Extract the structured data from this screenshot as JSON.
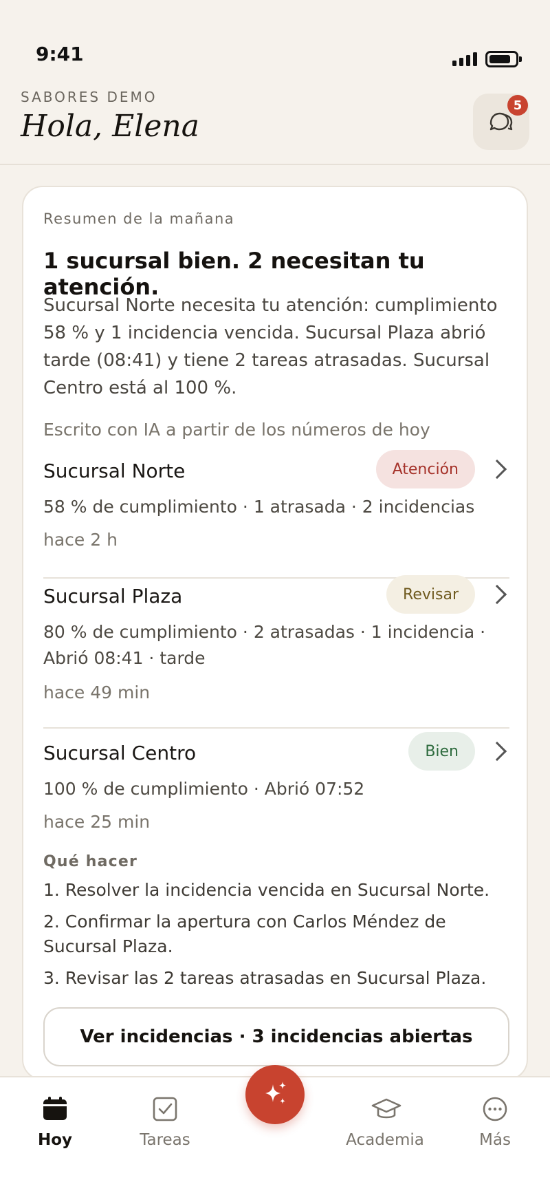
{
  "status_bar": {
    "time": "9:41"
  },
  "header": {
    "brand": "SABORES DEMO",
    "greeting": "Hola, Elena",
    "notifications_count": "5"
  },
  "summary_card": {
    "label": "Resumen de la mañana",
    "headline": "1 sucursal bien. 2 necesitan tu atención.",
    "body": "Sucursal Norte necesita tu atención: cumplimiento 58 % y 1 incidencia vencida. Sucursal Plaza abrió tarde (08:41) y tiene 2 tareas atrasadas. Sucursal Centro está al 100 %.",
    "ai_note": "Escrito con IA a partir de los números de hoy"
  },
  "branches": [
    {
      "name": "Sucursal Norte",
      "status": "Atención",
      "stats": "58 % de cumplimiento · 1 atrasada · 2 incidencias",
      "updated": "hace 2 h"
    },
    {
      "name": "Sucursal Plaza",
      "status": "Revisar",
      "stats": "80 % de cumplimiento · 2 atrasadas · 1 incidencia · Abrió 08:41 · tarde",
      "updated": "hace 49 min"
    },
    {
      "name": "Sucursal Centro",
      "status": "Bien",
      "stats": "100 % de cumplimiento · Abrió 07:52",
      "updated": "hace 25 min"
    }
  ],
  "todo": {
    "label": "Qué hacer",
    "items": [
      "1. Resolver la incidencia vencida en Sucursal Norte.",
      "2. Confirmar la apertura con Carlos Méndez de Sucursal Plaza.",
      "3. Revisar las 2 tareas atrasadas en Sucursal Plaza."
    ]
  },
  "cta": {
    "label": "Ver incidencias · 3 incidencias abiertas"
  },
  "tabbar": {
    "tabs": [
      {
        "label": "Hoy",
        "icon": "calendar-icon"
      },
      {
        "label": "Tareas",
        "icon": "checkbox-icon"
      },
      {
        "label": "Academia",
        "icon": "graduation-cap-icon"
      },
      {
        "label": "Más",
        "icon": "more-icon"
      }
    ],
    "center_icon": "sparkles-icon"
  },
  "colors": {
    "accent": "#c8432f",
    "background": "#f6f2ec",
    "attention": "#a5322a",
    "review": "#6f5a1f",
    "good": "#2e6b3e"
  }
}
